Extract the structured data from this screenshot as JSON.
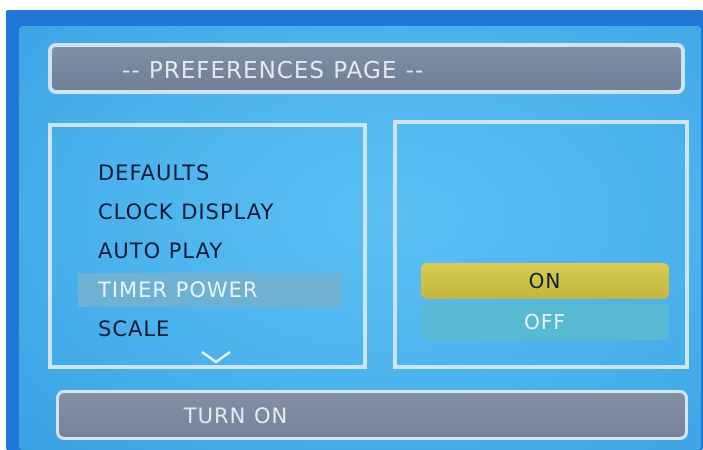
{
  "title": "-- PREFERENCES PAGE --",
  "menu": {
    "items": [
      {
        "label": "DEFAULTS"
      },
      {
        "label": "CLOCK DISPLAY"
      },
      {
        "label": "AUTO PLAY"
      },
      {
        "label": "TIMER POWER",
        "selected": true
      },
      {
        "label": "SCALE"
      }
    ]
  },
  "options": {
    "on_label": "ON",
    "off_label": "OFF",
    "highlighted": "ON"
  },
  "status": {
    "text": "TURN ON"
  },
  "icons": {
    "scroll_down": "chevron-down-icon"
  },
  "colors": {
    "screen_background": "#4ab2ec",
    "bar_background": "#7a879c",
    "highlight_option": "#d0c449",
    "selected_item": "#6eb1d2"
  }
}
